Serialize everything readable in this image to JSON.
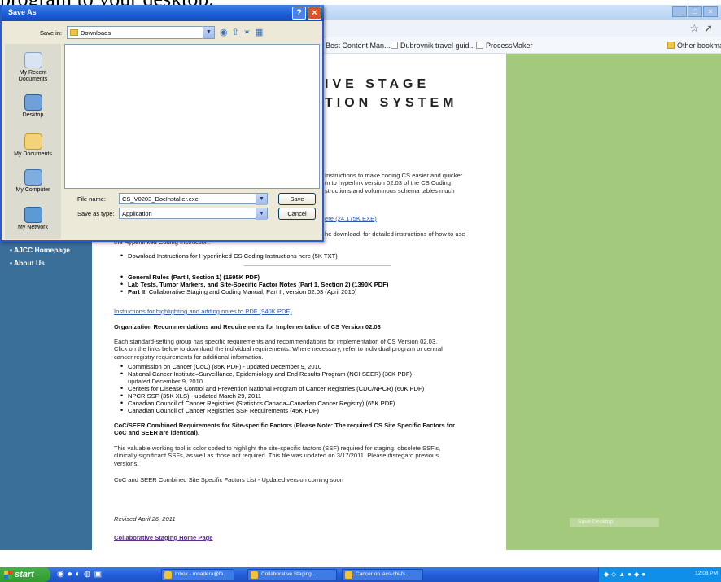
{
  "top_strip_text": "program to your desktop.",
  "browser": {
    "bookmarks": [
      "Best Content Man...",
      "Dubrovnik travel guid...",
      "ProcessMaker",
      "Other bookmarks"
    ]
  },
  "sidebar": {
    "items": [
      {
        "label": "AJCC Homepage"
      },
      {
        "label": "About Us"
      }
    ]
  },
  "page": {
    "headline_1": "IVE STAGE",
    "headline_2": "TION SYSTEM",
    "partial_para_1a": "Instructions to make coding CS easier and quicker",
    "partial_para_1b": "m to hyperlink version 02.03 of the CS Coding",
    "partial_para_1c": "structions and voluminous schema tables much",
    "partial_link_exe": "ere (24.175K EXE)",
    "partial_para_2": "he download, for detailed instructions of how to use",
    "partial_para_2b": "the Hyperlinked Coding Instruction.",
    "bullet_download": "Download Instructions for Hyperlinked CS Coding Instructions here (5K TXT)",
    "bullet_general": "General Rules (Part I, Section 1) (1695K PDF)",
    "bullet_lab": "Lab Tests, Tumor Markers, and Site-Specific Factor Notes (Part 1, Section 2) (1390K PDF)",
    "bullet_part2_prefix": "Part II:",
    "bullet_part2_rest": " Collaborative Staging and Coding Manual, Part II, version 02.03 (April 2010)",
    "highlight_link": "Instructions for highlighting and adding notes to PDF (940K PDF)",
    "org_heading": "Organization Recommendations and Requirements for Implementation of CS Version 02.03",
    "org_para_1": "Each standard-setting group has specific requirements and recommendations for implementation of CS Version 02.03.",
    "org_para_2": "Click on the links below to download the individual requirements. Where necessary, refer to individual program or central",
    "org_para_3": "cancer registry requirements for additional information.",
    "org_links": [
      {
        "link": "Commission on Cancer (CoC) (85K PDF)",
        "suffix": " - updated December 9, 2010"
      },
      {
        "link": "National Cancer Institute–Surveillance, Epidemiology and End Results Program (NCI-SEER) (30K PDF)",
        "suffix": " -"
      },
      {
        "link": "",
        "suffix": "updated December 9, 2010"
      },
      {
        "link": "Centers for Disease Control and Prevention National Program of Cancer Registries (CDC/NPCR) (60K PDF)",
        "suffix": ""
      },
      {
        "link": "NPCR SSF (35K XLS)",
        "suffix": " - updated March 29, 2011"
      },
      {
        "link": "Canadian Council of Cancer Registries (Statistics Canada–Canadian Cancer Registry) (65K PDF)",
        "suffix": ""
      },
      {
        "link": "Canadian Council of Cancer Registries SSF Requirements (45K PDF)",
        "suffix": ""
      }
    ],
    "coc_heading_1": "CoC/SEER Combined Requirements for Site-specific Factors (Please Note: The required CS Site Specific Factors for",
    "coc_heading_2": "CoC and SEER are identical).",
    "coc_para_1": "This valuable working tool is color coded to highlight the site-specific factors (SSF) required for staging, obsolete SSF's,",
    "coc_para_2": "clinically significant SSFs, as well as those not required. This file was updated on 3/17/2011. Please disregard previous",
    "coc_para_3": "versions.",
    "coc_list": "CoC and SEER Combined Site Specific Factors List - Updated version coming soon",
    "revised": "Revised April 26, 2011",
    "home_link": "Collaborative Staging Home Page",
    "save_desktop": "Save Desktop"
  },
  "dialog": {
    "title": "Save As",
    "help_label": "?",
    "close_label": "×",
    "save_in_label": "Save in:",
    "save_in_value": "Downloads",
    "places": [
      "My Recent Documents",
      "Desktop",
      "My Documents",
      "My Computer",
      "My Network"
    ],
    "file_name_label": "File name:",
    "file_name_value": "CS_V0203_DocInstaller.exe",
    "save_as_type_label": "Save as type:",
    "save_as_type_value": "Application",
    "save_button": "Save",
    "cancel_button": "Cancel"
  },
  "taskbar": {
    "start_label": "start",
    "tasks": [
      "Inbox - mnadera@fa...",
      "Collaborative Staging...",
      "Cancer on 'acs-chi-fs..."
    ],
    "clock": "12:03 PM"
  },
  "colors": {
    "left_band": "#3a6f9a",
    "right_green": "#a3c97c",
    "dialog_title": "#1c5bd4",
    "taskbar": "#245edb"
  }
}
